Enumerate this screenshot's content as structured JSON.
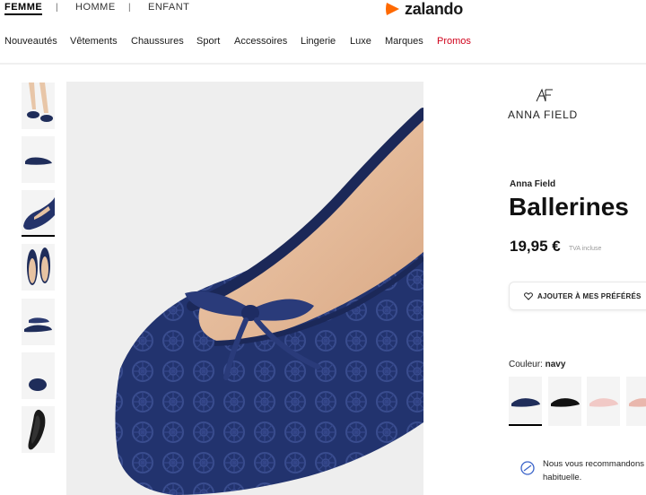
{
  "header": {
    "genders": [
      {
        "label": "FEMME",
        "active": true
      },
      {
        "label": "HOMME",
        "active": false
      },
      {
        "label": "ENFANT",
        "active": false
      }
    ],
    "separator": "|",
    "logo_text": "zalando",
    "brand_color": "#ff6900"
  },
  "nav": {
    "items": [
      "Nouveautés",
      "Vêtements",
      "Chaussures",
      "Sport",
      "Accessoires",
      "Lingerie",
      "Luxe",
      "Marques",
      "Promos"
    ],
    "promo_color": "#d0021b"
  },
  "gallery": {
    "thumbnail_count": 7,
    "active_index": 2,
    "main_image_icon": "navy-lace-ballerina-closeup"
  },
  "product": {
    "brand_logo_text": "ANNA FIELD",
    "brand": "Anna Field",
    "title": "Ballerines",
    "price": "19,95 €",
    "vat_note": "TVA incluse",
    "wishlist_label": "AJOUTER À MES PRÉFÉRÉS",
    "color_label": "Couleur:",
    "color_value": "navy",
    "swatches": [
      {
        "name": "navy",
        "active": true
      },
      {
        "name": "black",
        "active": false
      },
      {
        "name": "pink",
        "active": false
      },
      {
        "name": "nude",
        "active": false
      }
    ],
    "recommendation_text": "Nous vous recommandons habituelle."
  }
}
